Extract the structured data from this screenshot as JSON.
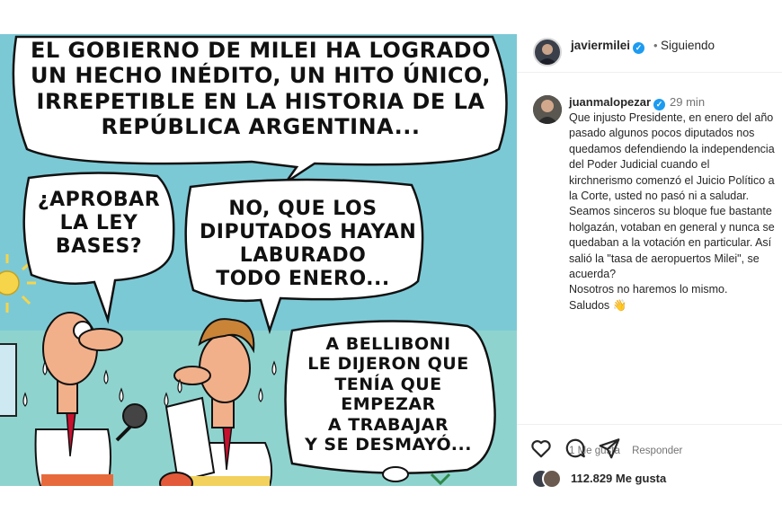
{
  "comic": {
    "main_bubble": [
      "El gobierno de Milei ha logrado",
      "un hecho inédito, un hito único,",
      "irrepetible en la historia de la",
      "República Argentina..."
    ],
    "left_bubble": [
      "¿Aprobar",
      "la ley",
      "bases?"
    ],
    "middle_bubble": [
      "No, que los",
      "diputados hayan",
      "laburado",
      "todo enero..."
    ],
    "right_bubble": [
      "A Belliboni",
      "le dijeron que",
      "tenía que",
      "empezar",
      "a trabajar",
      "y se desmayó..."
    ]
  },
  "post": {
    "author": "javiermilei",
    "separator": "•",
    "follow_status": "Siguiendo"
  },
  "comment": {
    "author": "juanmalopezar",
    "time": "29 min",
    "text": "Que injusto Presidente, en enero del año pasado algunos pocos diputados nos quedamos defendiendo la independencia del Poder Judicial cuando el kirchnerismo comenzó el Juicio Político a la Corte, usted no pasó ni a saludar.\nSeamos sinceros su bloque fue bastante holgazán, votaban en general y nunca se quedaban a la votación en particular. Así salió la \"tasa de aeropuertos Milei\", se acuerda?\nNosotros no haremos lo mismo.\nSaludos 👋",
    "likes": "1 Me gusta",
    "reply": "Responder"
  },
  "actions": {
    "icons": [
      "heart-icon",
      "comment-icon",
      "share-icon"
    ]
  },
  "likes_summary": "112.829 Me gusta",
  "colors": {
    "verified": "#1d9bf0",
    "sky": "#7cc9d6",
    "text": "#262626",
    "muted": "#737373"
  }
}
